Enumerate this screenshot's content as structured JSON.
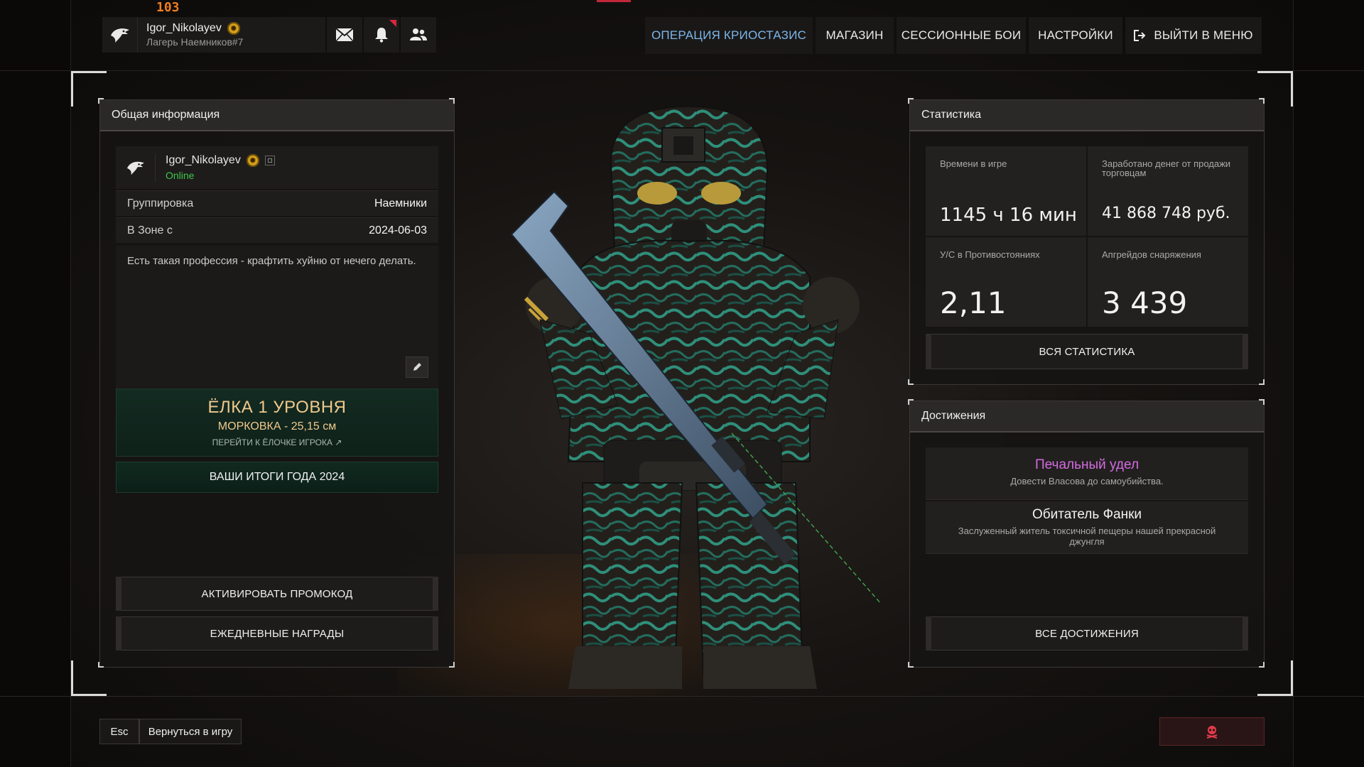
{
  "ping": "103",
  "profile": {
    "name": "Igor_Nikolayev",
    "clan": "Лагерь Наемников#7",
    "status": "Online"
  },
  "nav": {
    "operation": "ОПЕРАЦИЯ КРИОСТАЗИС",
    "shop": "МАГАЗИН",
    "sessions": "СЕССИОННЫЕ БОИ",
    "settings": "НАСТРОЙКИ",
    "exit": "ВЫЙТИ В МЕНЮ"
  },
  "info_panel": {
    "title": "Общая информация",
    "faction_label": "Группировка",
    "faction_value": "Наемники",
    "since_label": "В Зоне с",
    "since_value": "2024-06-03",
    "about": "Есть такая профессия - крафтить хуйню от нечего делать.",
    "tree_title": "ЁЛКА 1 УРОВНЯ",
    "tree_sub": "МОРКОВКА - 25,15 см",
    "tree_link": "ПЕРЕЙТИ К ЁЛОЧКЕ ИГРОКА",
    "year_results": "ВАШИ ИТОГИ ГОДА 2024",
    "promo_button": "АКТИВИРОВАТЬ ПРОМОКОД",
    "daily_button": "ЕЖЕДНЕВНЫЕ НАГРАДЫ"
  },
  "stats_panel": {
    "title": "Статистика",
    "items": [
      {
        "label": "Времени в игре",
        "value": "1145 ч 16 мин"
      },
      {
        "label": "Заработано денег от продажи торговцам",
        "value": "41 868 748 руб."
      },
      {
        "label": "У/С в Противостояниях",
        "value": "2,11"
      },
      {
        "label": "Апгрейдов снаряжения",
        "value": "3 439"
      }
    ],
    "all_button": "ВСЯ СТАТИСТИКА"
  },
  "achievements_panel": {
    "title": "Достижения",
    "items": [
      {
        "name": "Печальный удел",
        "desc": "Довести Власова до самоубийства.",
        "color": "#d36be0"
      },
      {
        "name": "Обитатель Фанки",
        "desc": "Заслуженный житель токсичной пещеры нашей прекрасной джунгля",
        "color": "#f2f2f2"
      }
    ],
    "all_button": "ВСЕ ДОСТИЖЕНИЯ"
  },
  "footer": {
    "esc_key": "Esc",
    "esc_label": "Вернуться в игру"
  },
  "colors": {
    "accent_blue": "#7cb6ea",
    "online_green": "#3ec74a",
    "ping_orange": "#f07d1f",
    "danger_red": "#d7263d"
  }
}
